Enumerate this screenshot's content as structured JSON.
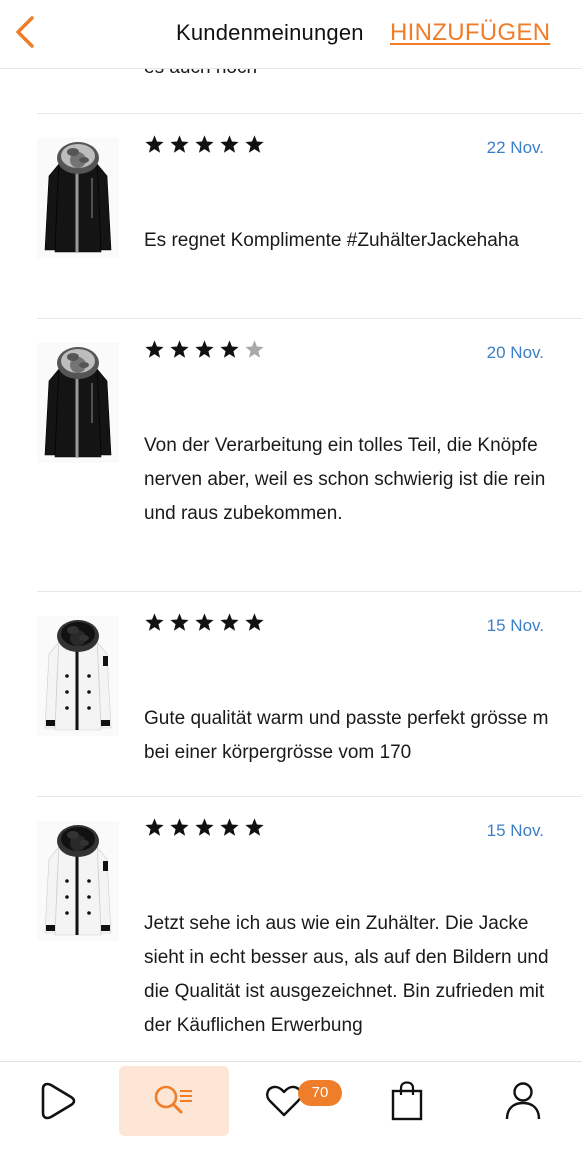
{
  "header": {
    "title": "Kundenmeinungen",
    "add_label": "HINZUFÜGEN"
  },
  "prev_review_tail": "es auch noch",
  "reviews": [
    {
      "rating": 5,
      "date": "22 Nov.",
      "text": "Es regnet Komplimente #ZuhälterJackehaha",
      "product_color": "black"
    },
    {
      "rating": 4,
      "date": "20 Nov.",
      "text": "Von der Verarbeitung ein tolles Teil, die Knöpfe nerven aber, weil es schon schwierig ist die rein und raus zubekommen.",
      "product_color": "black"
    },
    {
      "rating": 5,
      "date": "15 Nov.",
      "text": "Gute qualität warm und passte perfekt grösse m bei einer körpergrösse vom 170",
      "product_color": "white"
    },
    {
      "rating": 5,
      "date": "15 Nov.",
      "text": "Jetzt sehe ich aus wie ein Zuhälter. Die Jacke sieht in echt besser aus, als auf den Bildern und die Qualität ist ausgezeichnet. Bin zufrieden mit der Käuflichen Erwerbung",
      "product_color": "white"
    }
  ],
  "tabbar": {
    "wishlist_count": "70",
    "icons": [
      "home-icon",
      "search-list-icon",
      "heart-icon",
      "bag-icon",
      "profile-icon"
    ]
  },
  "colors": {
    "accent": "#ef7d2a",
    "date_blue": "#3d7fc7",
    "star_filled": "#111111",
    "star_empty": "#a8a8a8",
    "active_tab_bg": "#fde6d5"
  }
}
